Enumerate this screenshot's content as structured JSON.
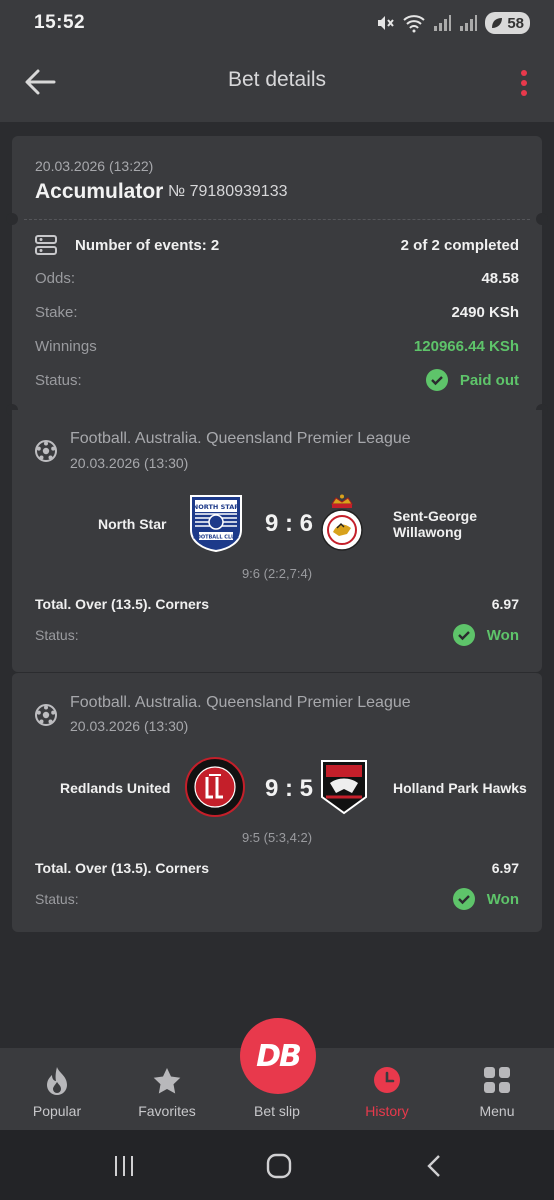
{
  "status_bar": {
    "time": "15:52",
    "battery": "58"
  },
  "header": {
    "title": "Bet details"
  },
  "bet": {
    "datetime": "20.03.2026 (13:22)",
    "type": "Accumulator",
    "number": "№ 79180939133",
    "events_label": "Number of events: 2",
    "completed": "2 of 2 completed",
    "odds_label": "Odds:",
    "odds": "48.58",
    "stake_label": "Stake:",
    "stake": "2490 KSh",
    "winnings_label": "Winnings",
    "winnings": "120966.44 KSh",
    "status_label": "Status:",
    "status": "Paid out"
  },
  "events": [
    {
      "league": "Football. Australia. Queensland Premier League",
      "datetime": "20.03.2026 (13:30)",
      "home": "North Star",
      "away_line1": "Sent-George",
      "away_line2": "Willawong",
      "score": "9 : 6",
      "sub_score": "9:6 (2:2,7:4)",
      "market": "Total. Over (13.5). Corners",
      "odds": "6.97",
      "status_label": "Status:",
      "status": "Won",
      "home_logo_text": "NORTH STAR",
      "home_logo_text2": "FOOTBALL CLUB"
    },
    {
      "league": "Football. Australia. Queensland Premier League",
      "datetime": "20.03.2026 (13:30)",
      "home": "Redlands United",
      "away": "Holland Park Hawks",
      "score": "9 : 5",
      "sub_score": "9:5 (5:3,4:2)",
      "market": "Total. Over (13.5). Corners",
      "odds": "6.97",
      "status_label": "Status:",
      "status": "Won"
    }
  ],
  "nav": {
    "popular": "Popular",
    "favorites": "Favorites",
    "bet_slip": "Bet slip",
    "history": "History",
    "menu": "Menu",
    "fab_logo": "DB"
  },
  "colors": {
    "accent": "#e8394c",
    "success": "#5ec46a",
    "card": "#3a3b3e",
    "background": "#2b2c2f"
  }
}
